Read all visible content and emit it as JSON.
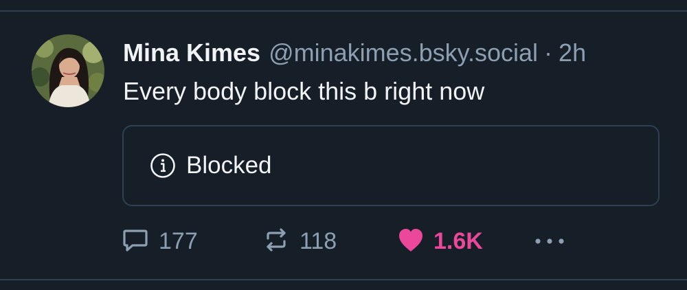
{
  "post": {
    "author": {
      "display_name": "Mina Kimes",
      "handle": "@minakimes.bsky.social"
    },
    "separator": "·",
    "time": "2h",
    "text": "Every body block this b right now",
    "embed": {
      "label": "Blocked",
      "icon": "info-circle-icon"
    },
    "actions": {
      "reply": {
        "icon": "reply-icon",
        "count": "177"
      },
      "repost": {
        "icon": "repost-icon",
        "count": "118"
      },
      "like": {
        "icon": "heart-icon",
        "count": "1.6K",
        "liked": true
      },
      "more": {
        "icon": "more-horizontal-icon"
      }
    }
  },
  "colors": {
    "background": "#161e27",
    "divider": "#2e4052",
    "text_primary": "#f1f3f5",
    "text_secondary": "#8d9fb2",
    "like_accent": "#ec4899"
  }
}
